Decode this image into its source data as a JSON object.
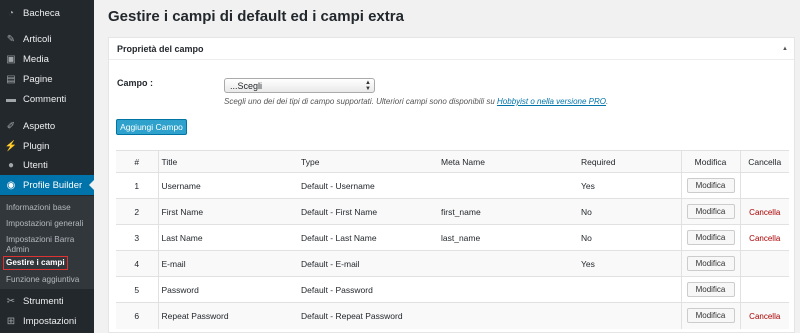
{
  "sidebar": {
    "items": [
      {
        "label": "Bacheca",
        "icon": "dashboard-icon"
      },
      {
        "label": "Articoli",
        "icon": "pin-icon"
      },
      {
        "label": "Media",
        "icon": "media-icon"
      },
      {
        "label": "Pagine",
        "icon": "page-icon"
      },
      {
        "label": "Commenti",
        "icon": "comment-icon"
      },
      {
        "label": "Aspetto",
        "icon": "brush-icon"
      },
      {
        "label": "Plugin",
        "icon": "plugin-icon"
      },
      {
        "label": "Utenti",
        "icon": "user-icon"
      },
      {
        "label": "Profile Builder",
        "icon": "profile-icon"
      },
      {
        "label": "Strumenti",
        "icon": "wrench-icon"
      },
      {
        "label": "Impostazioni",
        "icon": "settings-icon"
      }
    ],
    "submenu": [
      "Informazioni base",
      "Impostazioni generali",
      "Impostazioni Barra Admin",
      "Gestire i campi",
      "Funzione aggiuntiva"
    ]
  },
  "page": {
    "title": "Gestire i campi di default ed i campi extra"
  },
  "panel": {
    "heading": "Proprietà del campo",
    "field_label": "Campo :",
    "select_value": "...Scegli",
    "help_text": "Scegli uno dei dei tipi di campo supportati. Ulteriori campi sono disponibili su ",
    "help_link": "Hobbyist o nella versione PRO",
    "help_end": ".",
    "add_button": "Aggiungi Campo"
  },
  "table": {
    "headers": [
      "#",
      "Title",
      "Type",
      "Meta Name",
      "Required",
      "Modifica",
      "Cancella"
    ],
    "rows": [
      {
        "num": "1",
        "title": "Username",
        "type": "Default - Username",
        "meta": "",
        "required": "Yes",
        "edit": "Modifica",
        "del": ""
      },
      {
        "num": "2",
        "title": "First Name",
        "type": "Default - First Name",
        "meta": "first_name",
        "required": "No",
        "edit": "Modifica",
        "del": "Cancella"
      },
      {
        "num": "3",
        "title": "Last Name",
        "type": "Default - Last Name",
        "meta": "last_name",
        "required": "No",
        "edit": "Modifica",
        "del": "Cancella"
      },
      {
        "num": "4",
        "title": "E-mail",
        "type": "Default - E-mail",
        "meta": "",
        "required": "Yes",
        "edit": "Modifica",
        "del": ""
      },
      {
        "num": "5",
        "title": "Password",
        "type": "Default - Password",
        "meta": "",
        "required": "",
        "edit": "Modifica",
        "del": ""
      },
      {
        "num": "6",
        "title": "Repeat Password",
        "type": "Default - Repeat Password",
        "meta": "",
        "required": "",
        "edit": "Modifica",
        "del": "Cancella"
      }
    ]
  }
}
